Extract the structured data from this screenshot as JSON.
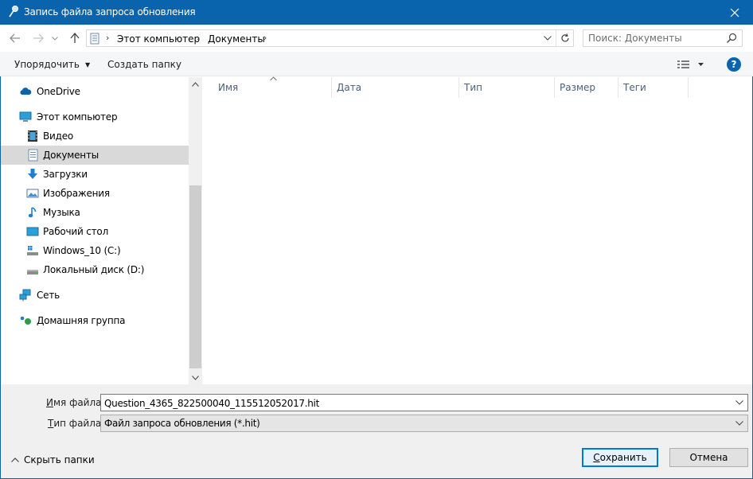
{
  "window": {
    "title": "Запись файла запроса обновления",
    "accent_color": "#0a64ad"
  },
  "nav": {
    "breadcrumbs": [
      "Этот компьютер",
      "Документы"
    ],
    "search_placeholder": "Поиск: Документы"
  },
  "toolbar": {
    "organize_label": "Упорядочить",
    "new_folder_label": "Создать папку",
    "help_label": "?"
  },
  "sidebar": {
    "items": [
      {
        "label": "OneDrive",
        "icon": "cloud-icon"
      },
      {
        "label": "Этот компьютер",
        "icon": "computer-icon"
      },
      {
        "label": "Видео",
        "icon": "film-icon"
      },
      {
        "label": "Документы",
        "icon": "document-icon",
        "selected": true
      },
      {
        "label": "Загрузки",
        "icon": "download-arrow-icon"
      },
      {
        "label": "Изображения",
        "icon": "image-icon"
      },
      {
        "label": "Музыка",
        "icon": "music-note-icon"
      },
      {
        "label": "Рабочий стол",
        "icon": "desktop-icon"
      },
      {
        "label": "Windows_10 (C:)",
        "icon": "system-drive-icon"
      },
      {
        "label": "Локальный диск (D:)",
        "icon": "drive-icon"
      },
      {
        "label": "Сеть",
        "icon": "network-icon"
      },
      {
        "label": "Домашняя группа",
        "icon": "homegroup-icon"
      }
    ]
  },
  "columns": [
    "Имя",
    "Дата",
    "Тип",
    "Размер",
    "Теги"
  ],
  "form": {
    "filename_label_prefix": "И",
    "filename_label_rest": "мя файла:",
    "filename_value": "Question_4365_822500040_115512052017.hit",
    "filetype_label_prefix": "Т",
    "filetype_label_rest": "ип файла:",
    "filetype_value": "Файл запроса обновления (*.hit)"
  },
  "footer": {
    "hide_folders_label": "Скрыть папки",
    "save_label_prefix": "С",
    "save_label_rest": "охранить",
    "cancel_label": "Отмена"
  }
}
